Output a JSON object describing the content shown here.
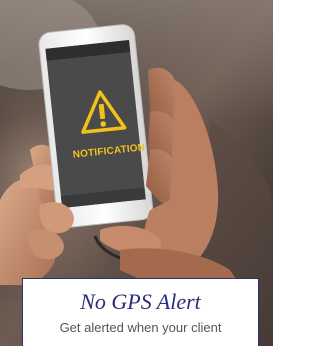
{
  "screen": {
    "notification_label": "NOTIFICATION",
    "caption_title": "No GPS Alert",
    "caption_text": "Get alerted when your client"
  },
  "colors": {
    "warning_yellow": "#f2c21b",
    "title_navy": "#2a2d78",
    "border_navy": "#2c2f7a",
    "phone_screen": "#4a4a4a"
  },
  "icons": {
    "warning": "warning-triangle-icon"
  }
}
